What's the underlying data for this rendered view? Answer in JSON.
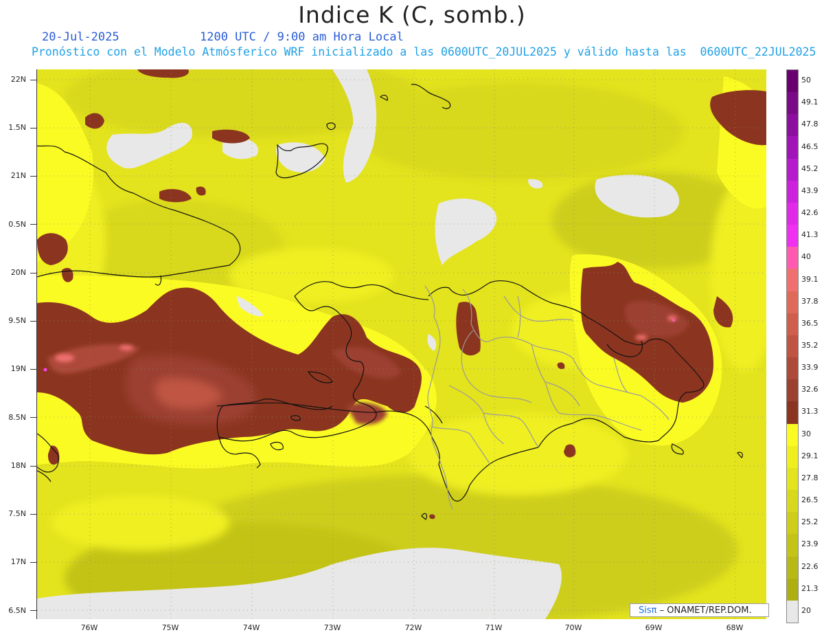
{
  "header": {
    "title": "Indice K (C, somb.)",
    "date": "20-Jul-2025",
    "time": "1200 UTC / 9:00 am Hora Local",
    "description": "Pronóstico con el Modelo Atmósferico WRF inicializado a las 0600UTC_20JUL2025 y válido hasta las  0600UTC_22JUL2025"
  },
  "axes": {
    "lat_labels": [
      "22N",
      "1.5N",
      "21N",
      "0.5N",
      "20N",
      "9.5N",
      "19N",
      "8.5N",
      "18N",
      "7.5N",
      "17N",
      "6.5N"
    ],
    "lon_labels": [
      "76W",
      "75W",
      "74W",
      "73W",
      "72W",
      "71W",
      "70W",
      "69W",
      "68W"
    ]
  },
  "legend": {
    "labels": [
      "50",
      "49.1",
      "47.8",
      "46.5",
      "45.2",
      "43.9",
      "42.6",
      "41.3",
      "40",
      "39.1",
      "37.8",
      "36.5",
      "35.2",
      "33.9",
      "32.6",
      "31.3",
      "30",
      "29.1",
      "27.8",
      "26.5",
      "25.2",
      "23.9",
      "22.6",
      "21.3",
      "20"
    ],
    "colors": [
      "#6a0070",
      "#7a0a88",
      "#8d0fa0",
      "#a014b8",
      "#b51ccc",
      "#cc22dd",
      "#e02ae8",
      "#f030f0",
      "#ff5ab0",
      "#f07070",
      "#e06a5a",
      "#cf5e4c",
      "#bf5442",
      "#ad4a3a",
      "#9c4030",
      "#8b3520",
      "#fbfb24",
      "#efef20",
      "#e3e31e",
      "#d8d81c",
      "#cdcd1a",
      "#c3c318",
      "#b9b916",
      "#afaf14",
      "#e8e8e8"
    ]
  },
  "credit": {
    "brand": "Sisπ",
    "org": " – ONAMET/REP.DOM."
  }
}
